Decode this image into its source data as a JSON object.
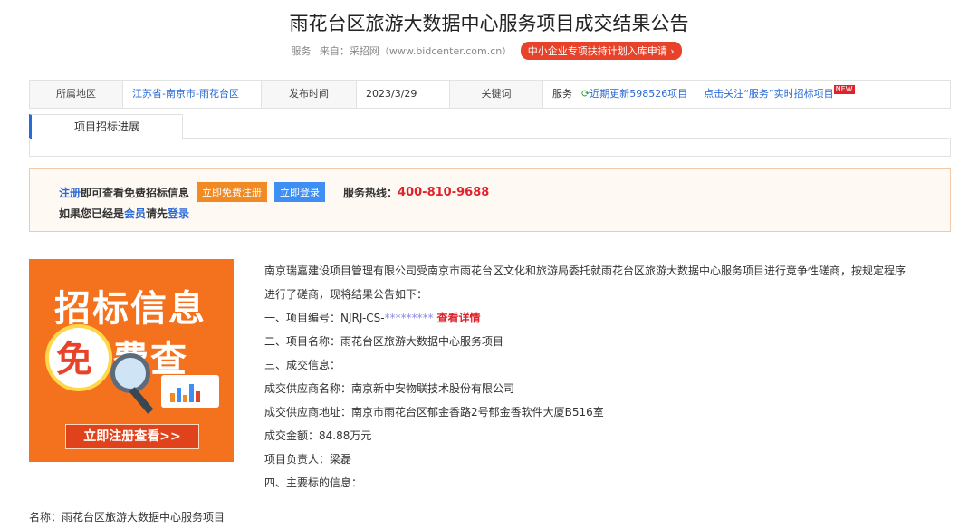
{
  "title": "雨花台区旅游大数据中心服务项目成交结果公告",
  "meta": {
    "category": "服务",
    "source": "来自：采招网（www.bidcenter.com.cn）",
    "promo": "中小企业专项扶持计划入库申请 ›"
  },
  "info": {
    "region_label": "所属地区",
    "region_value": "江苏省-南京市-雨花台区",
    "date_label": "发布时间",
    "date_value": "2023/3/29",
    "keyword_label": "关键词",
    "keyword_value": "服务",
    "refresh_text": "近期更新598526项目",
    "follow_text": "点击关注“服务”实时招标项目",
    "new_badge": "NEW"
  },
  "tabs": [
    "项目招标进展"
  ],
  "notice": {
    "register_link": "注册",
    "line1_text": "即可查看免费招标信息",
    "register_btn": "立即免费注册",
    "login_btn": "立即登录",
    "hotline_label": "服务热线：",
    "hotline": "400-810-9688",
    "line2_a": "如果您已经是",
    "member_link": "会员",
    "line2_b": "请先",
    "login_link": "登录"
  },
  "ad": {
    "line1": "招标信息",
    "mian": "免",
    "line2": "费查",
    "cta": "立即注册查看>>"
  },
  "body": {
    "para1": "南京瑞嘉建设项目管理有限公司受南京市雨花台区文化和旅游局委托就雨花台区旅游大数据中心服务项目进行竞争性磋商，按规定程序",
    "para1b": "进行了磋商，现将结果公告如下：",
    "item1_prefix": "一、项目编号：NJRJ-CS-",
    "item1_stars": "*********",
    "item1_link": "查看详情",
    "item2": "二、项目名称：雨花台区旅游大数据中心服务项目",
    "item3": "三、成交信息：",
    "supplier_name": "成交供应商名称：南京新中安物联技术股份有限公司",
    "supplier_addr": "成交供应商地址：南京市雨花台区郁金香路2号郁金香软件大厦B516室",
    "amount": "成交金额：84.88万元",
    "manager": "项目负责人：梁磊",
    "item4": "四、主要标的信息："
  },
  "footer_name": "名称：雨花台区旅游大数据中心服务项目"
}
